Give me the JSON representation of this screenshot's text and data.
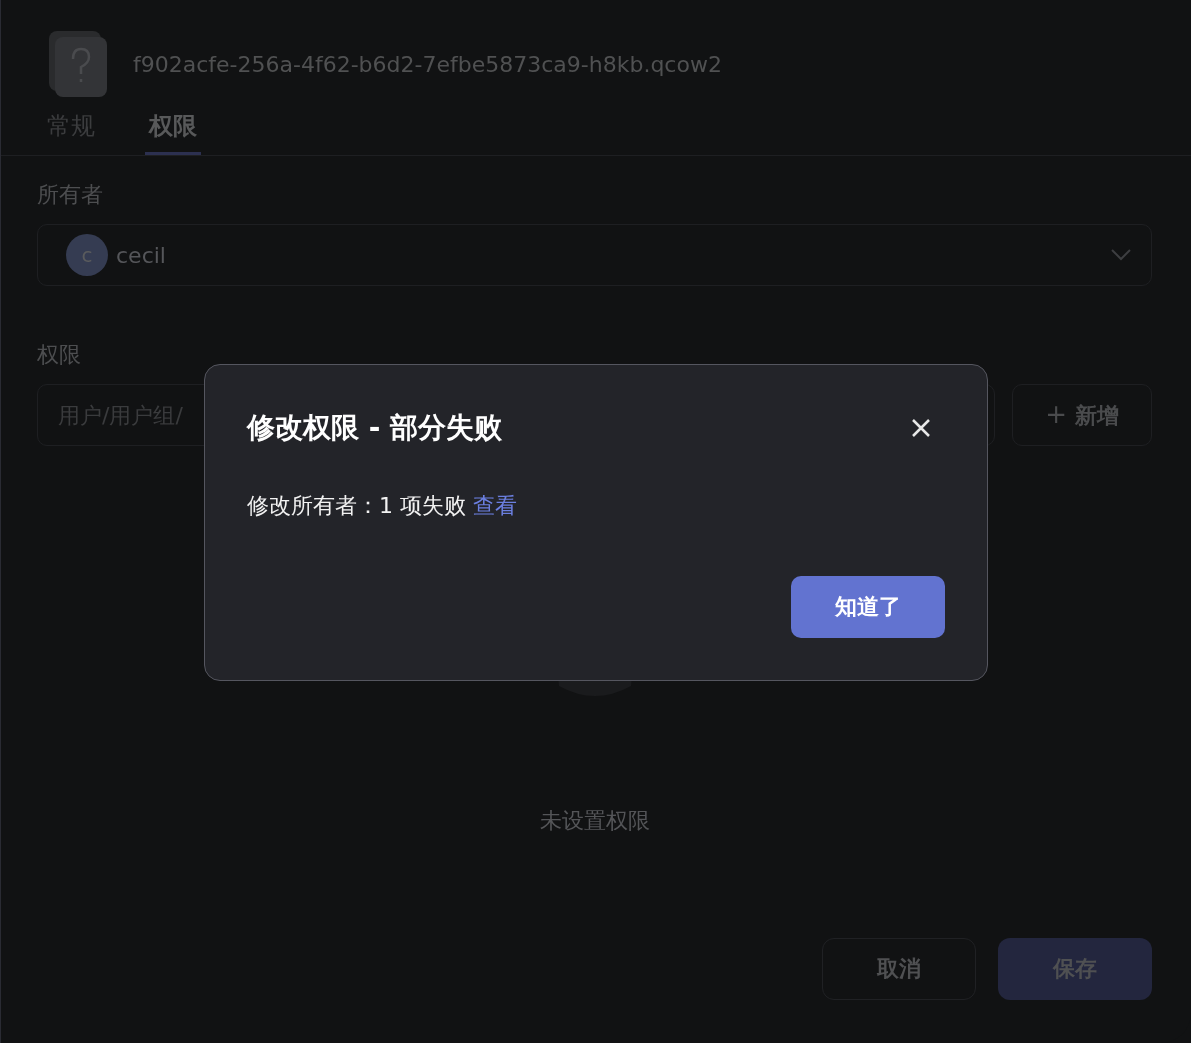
{
  "header": {
    "file_name": "f902acfe-256a-4f62-b6d2-7efbe5873ca9-h8kb.qcow2"
  },
  "tabs": [
    {
      "label": "常规",
      "selected": false
    },
    {
      "label": "权限",
      "selected": true
    }
  ],
  "owner": {
    "label": "所有者",
    "avatar_letter": "c",
    "value": "cecil"
  },
  "permissions": {
    "label": "权限",
    "search_placeholder": "用户/用户组/",
    "add_button": {
      "icon": "+",
      "label": "新增"
    },
    "empty_text": "未设置权限"
  },
  "footer": {
    "buttons": [
      {
        "label": "取消",
        "kind": "secondary"
      },
      {
        "label": "保存",
        "kind": "primary"
      }
    ]
  },
  "dialog": {
    "title": "修改权限 - 部分失败",
    "message": "修改所有者：1 项失败",
    "link": "查看",
    "button": "知道了"
  }
}
